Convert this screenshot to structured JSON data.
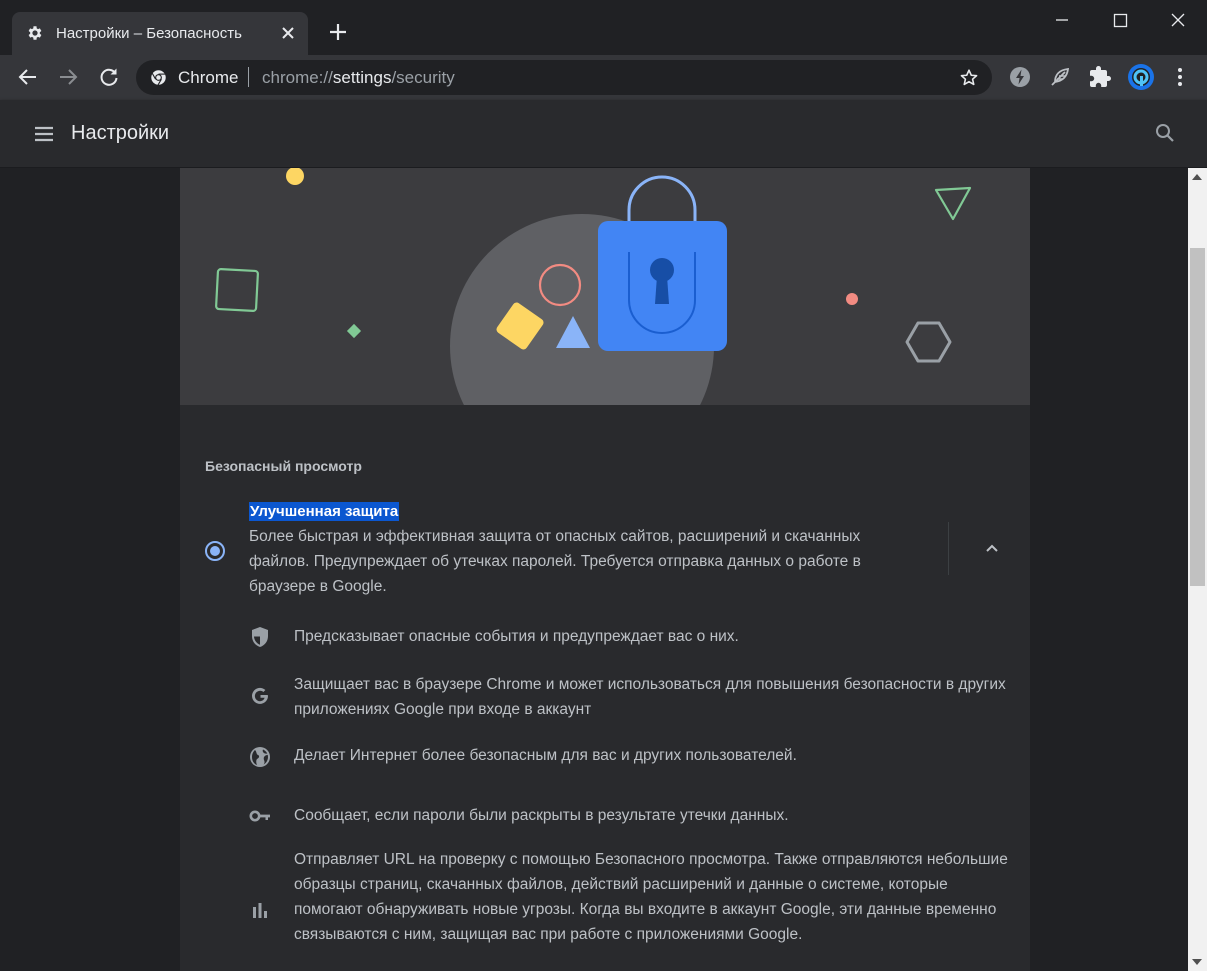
{
  "window": {
    "tab_title": "Настройки – Безопасность",
    "tab_icon": "gear-icon",
    "controls": [
      "minimize-icon",
      "maximize-icon",
      "close-icon"
    ]
  },
  "toolbar": {
    "site_chip": "Chrome",
    "url_scheme": "chrome://",
    "url_host": "settings",
    "url_path": "/security"
  },
  "header": {
    "title": "Настройки"
  },
  "safe_browsing": {
    "section_title": "Безопасный просмотр",
    "option": {
      "label": "Улучшенная защита",
      "description": "Более быстрая и эффективная защита от опасных сайтов, расширений и скачанных файлов. Предупреждает об утечках паролей. Требуется отправка данных о работе в браузере в Google.",
      "selected": true
    },
    "features": [
      {
        "icon": "shield-icon",
        "text": "Предсказывает опасные события и предупреждает вас о них."
      },
      {
        "icon": "google-g-icon",
        "text": "Защищает вас в браузере Chrome и может использоваться для повышения безопасности в других приложениях Google при входе в аккаунт"
      },
      {
        "icon": "globe-icon",
        "text": "Делает Интернет более безопасным для вас и других пользователей."
      },
      {
        "icon": "key-icon",
        "text": "Сообщает, если пароли были раскрыты в результате утечки данных."
      },
      {
        "icon": "bar-chart-icon",
        "text": "Отправляет URL на проверку с помощью Безопасного просмотра. Также отправляются небольшие образцы страниц, скачанных файлов, действий расширений и данные о системе, которые помогают обнаруживать новые угрозы. Когда вы входите в аккаунт Google, эти данные временно связываются с ним, защищая вас при работе с приложениями Google."
      }
    ]
  },
  "colors": {
    "accent": "#8ab4f8",
    "selection": "#0b57d0",
    "lock_blue": "#4285f4",
    "background": "#202124",
    "card": "#292a2d"
  }
}
